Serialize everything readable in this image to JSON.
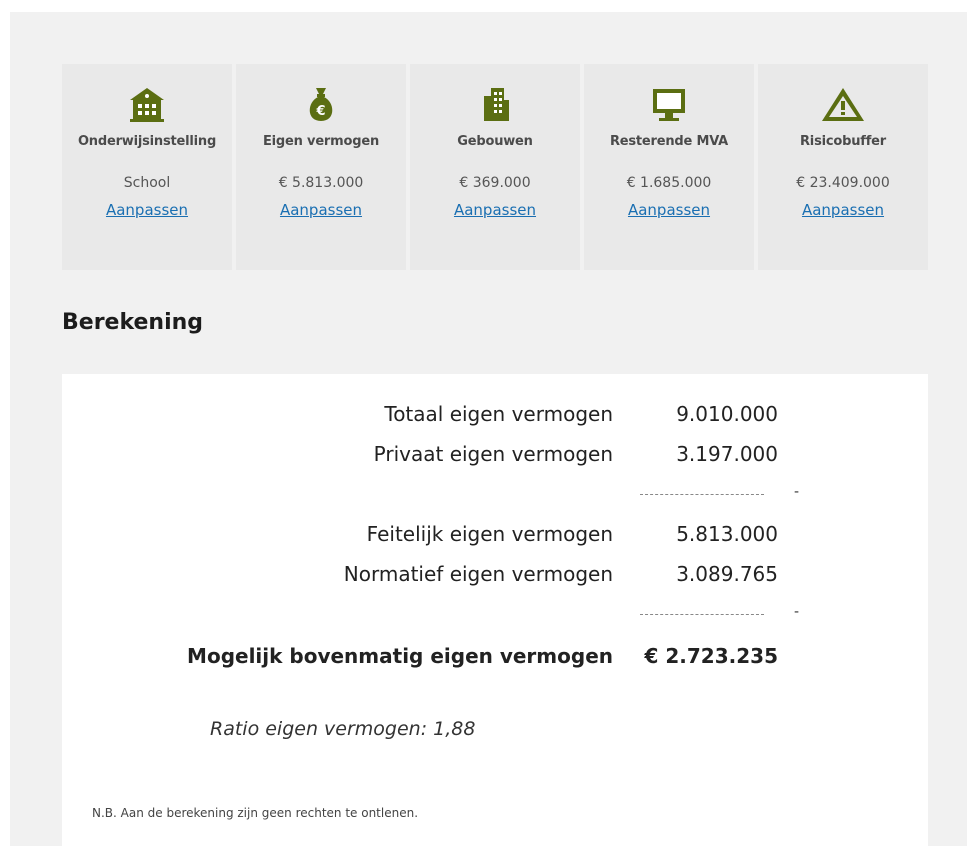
{
  "cards": [
    {
      "icon": "school-building-icon",
      "title": "Onderwijsinstelling",
      "value": "School",
      "link": "Aanpassen"
    },
    {
      "icon": "money-bag-icon",
      "title": "Eigen vermogen",
      "value": "€ 5.813.000",
      "link": "Aanpassen"
    },
    {
      "icon": "office-building-icon",
      "title": "Gebouwen",
      "value": "€ 369.000",
      "link": "Aanpassen"
    },
    {
      "icon": "monitor-icon",
      "title": "Resterende MVA",
      "value": "€ 1.685.000",
      "link": "Aanpassen"
    },
    {
      "icon": "warning-icon",
      "title": "Risicobuffer",
      "value": "€ 23.409.000",
      "link": "Aanpassen"
    }
  ],
  "section_title": "Berekening",
  "rows": [
    {
      "label": "Totaal eigen vermogen",
      "value": "9.010.000"
    },
    {
      "label": "Privaat eigen vermogen",
      "value": "3.197.000"
    },
    {
      "label": "Feitelijk eigen vermogen",
      "value": "5.813.000"
    },
    {
      "label": "Normatief eigen vermogen",
      "value": "3.089.765"
    },
    {
      "label": "Mogelijk bovenmatig eigen vermogen",
      "value": "€ 2.723.235"
    }
  ],
  "minus_sign": "-",
  "ratio": "Ratio eigen vermogen: 1,88",
  "note": "N.B. Aan de berekening zijn geen rechten te ontlenen.",
  "colors": {
    "icon": "#5b6e12",
    "link": "#1a6fb2",
    "panel": "#f1f1f1",
    "card": "#e9e9e9"
  }
}
